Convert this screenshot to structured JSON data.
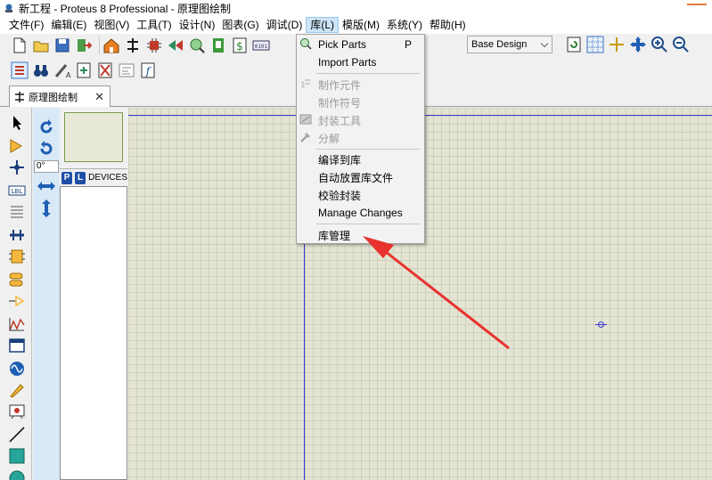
{
  "window": {
    "title": "新工程 - Proteus 8 Professional - 原理图绘制"
  },
  "menubar": {
    "items": [
      {
        "label": "文件(F)"
      },
      {
        "label": "编辑(E)"
      },
      {
        "label": "视图(V)"
      },
      {
        "label": "工具(T)"
      },
      {
        "label": "设计(N)"
      },
      {
        "label": "图表(G)"
      },
      {
        "label": "调试(D)"
      },
      {
        "label": "库(L)",
        "active": true
      },
      {
        "label": "模版(M)"
      },
      {
        "label": "系统(Y)"
      },
      {
        "label": "帮助(H)"
      }
    ]
  },
  "toolbar": {
    "design_variant": "Base Design"
  },
  "tab": {
    "label": "原理图绘制"
  },
  "sidebar": {
    "rotation_angle": "0°",
    "devices_label": "DEVICES",
    "pick_button": "P",
    "library_button": "L"
  },
  "library_menu": {
    "items": [
      {
        "label": "Pick Parts",
        "shortcut": "P",
        "enabled": true,
        "icon": "pick-parts-icon"
      },
      {
        "label": "Import Parts",
        "enabled": true
      },
      {
        "label": "制作元件",
        "enabled": false,
        "icon": "make-device-icon"
      },
      {
        "label": "制作符号",
        "enabled": false
      },
      {
        "label": "封装工具",
        "enabled": false,
        "icon": "package-tool-icon"
      },
      {
        "label": "分解",
        "enabled": false,
        "icon": "decompose-icon"
      },
      {
        "label": "编译到库",
        "enabled": true
      },
      {
        "label": "自动放置库文件",
        "enabled": true
      },
      {
        "label": "校验封装",
        "enabled": true
      },
      {
        "label": "Manage Changes",
        "enabled": true
      },
      {
        "label": "库管理",
        "enabled": true
      }
    ]
  },
  "colors": {
    "annotation_arrow": "#e8322e",
    "sheet_border": "#3a3ad0",
    "canvas_bg": "#e4e4d2",
    "menu_highlight": "#cce4f7"
  }
}
